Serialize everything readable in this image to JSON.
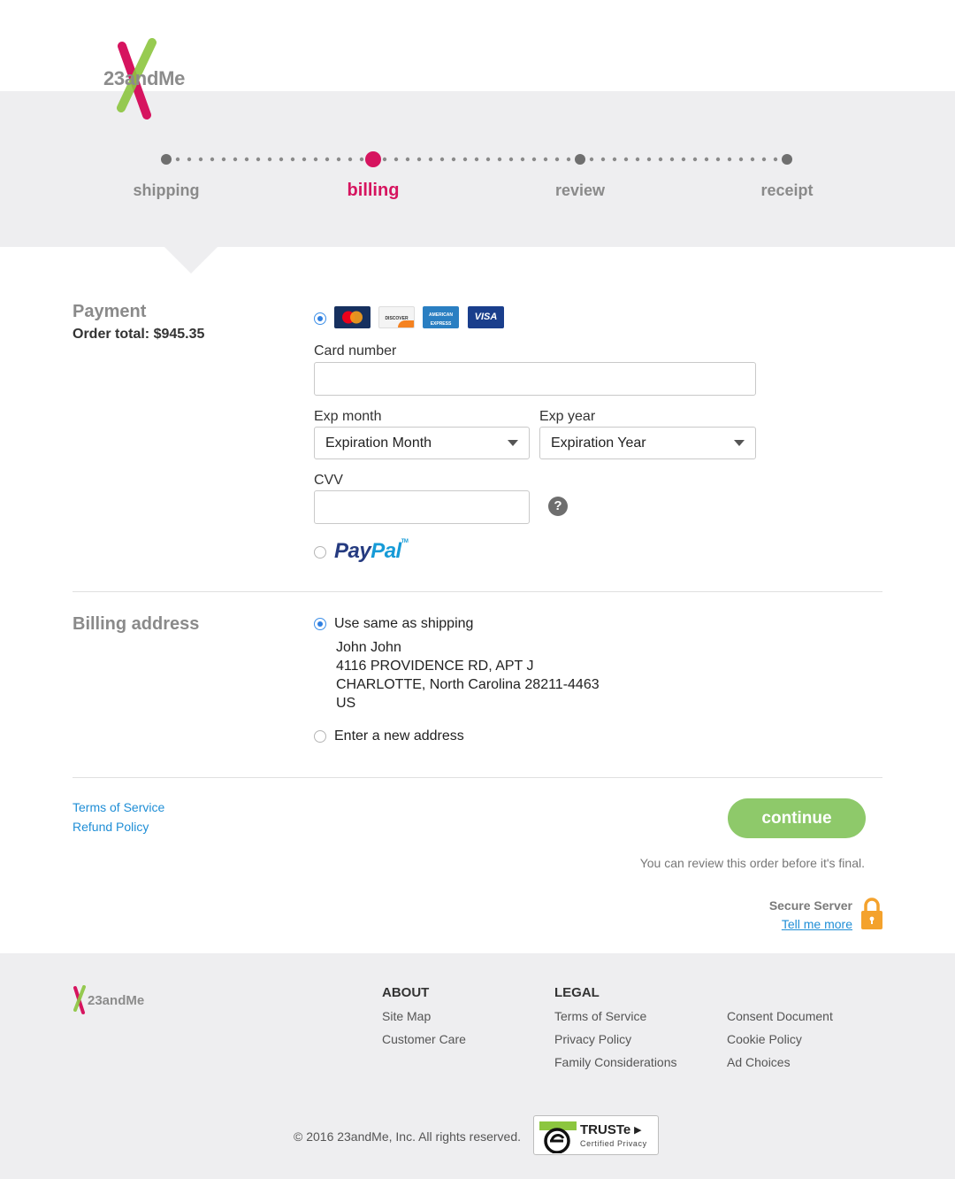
{
  "brand": {
    "name": "23andMe",
    "colors": {
      "pink": "#d6145f",
      "green": "#8cc63f",
      "footer_bg": "#eeeef0"
    }
  },
  "progress": {
    "steps": [
      {
        "label": "shipping",
        "active": false
      },
      {
        "label": "billing",
        "active": true
      },
      {
        "label": "review",
        "active": false
      },
      {
        "label": "receipt",
        "active": false
      }
    ]
  },
  "payment": {
    "title": "Payment",
    "order_total": "Order total: $945.35",
    "cards": [
      "MasterCard",
      "DISCOVER",
      "AMERICAN EXPRESS",
      "VISA"
    ],
    "card_number_label": "Card number",
    "card_number_value": "",
    "exp_month_label": "Exp month",
    "exp_month_value": "Expiration Month",
    "exp_year_label": "Exp year",
    "exp_year_value": "Expiration Year",
    "cvv_label": "CVV",
    "cvv_value": "",
    "help_icon": "?",
    "paypal": {
      "part1": "Pay",
      "part2": "Pal",
      "tm": "TM"
    }
  },
  "billing": {
    "title": "Billing address",
    "same_as_shipping_label": "Use same as shipping",
    "address": [
      "John John",
      "4116 PROVIDENCE RD, APT J",
      "CHARLOTTE, North Carolina 28211-4463",
      "US"
    ],
    "new_address_label": "Enter a new address"
  },
  "actions": {
    "terms_link": "Terms of Service",
    "refund_link": "Refund Policy",
    "continue_label": "continue",
    "review_note": "You can review this order before it's final.",
    "secure_title": "Secure Server",
    "secure_link": "Tell me more"
  },
  "footer": {
    "logo_text": "23andMe",
    "about_heading": "ABOUT",
    "about_links": [
      "Site Map",
      "Customer Care"
    ],
    "legal_heading": "LEGAL",
    "legal_links_col1": [
      "Terms of Service",
      "Privacy Policy",
      "Family Considerations"
    ],
    "legal_links_col2": [
      "Consent Document",
      "Cookie Policy",
      "Ad Choices"
    ],
    "copyright": "© 2016 23andMe, Inc. All rights reserved.",
    "truste_name": "TRUSTe",
    "truste_sub": "Certified Privacy"
  }
}
